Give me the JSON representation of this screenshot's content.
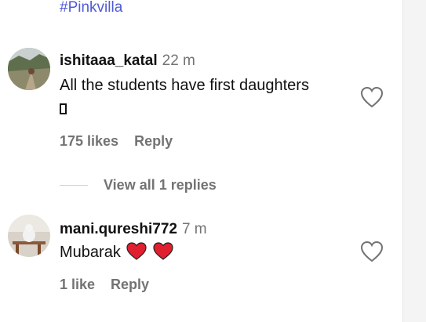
{
  "hashtag": "#Pinkvilla",
  "comments": [
    {
      "username": "ishitaaa_katal",
      "time": "22 m",
      "text": "All the students have first daughters",
      "likes": "175 likes",
      "reply": "Reply"
    },
    {
      "username": "mani.qureshi772",
      "time": "7 m",
      "text": "Mubarak",
      "likes": "1 like",
      "reply": "Reply"
    }
  ],
  "view_replies": "View all 1 replies",
  "colors": {
    "hashtag": "#4f5bd5",
    "muted": "#737373",
    "emoji_heart": "#e0202e"
  },
  "icons": [
    "heart-outline-icon",
    "red-heart-emoji",
    "missing-glyph"
  ]
}
